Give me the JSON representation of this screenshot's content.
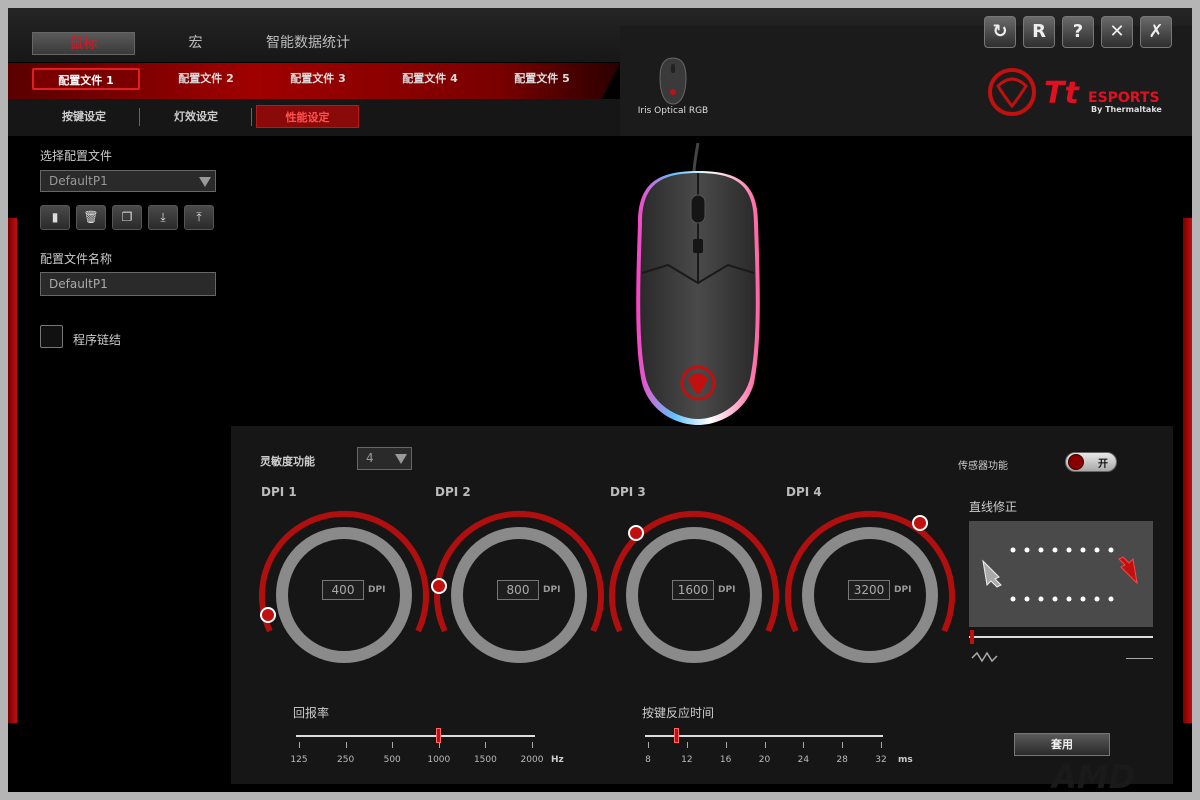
{
  "main_tabs": [
    "鼠标",
    "宏",
    "智能数据统计"
  ],
  "profile_tabs": [
    "配置文件 1",
    "配置文件 2",
    "配置文件 3",
    "配置文件 4",
    "配置文件 5"
  ],
  "sub_tabs": [
    "按键设定",
    "灯效设定",
    "性能设定"
  ],
  "device_name": "Iris Optical RGB",
  "brand": {
    "logo_main": "Tt",
    "logo_sub": "ESPORTS",
    "logo_by": "By Thermaltake"
  },
  "left": {
    "select_profile_label": "选择配置文件",
    "profile_selected": "DefaultP1",
    "profile_name_label": "配置文件名称",
    "profile_name_value": "DefaultP1",
    "program_link_label": "程序链结",
    "icons": [
      "save-icon",
      "trash-icon",
      "copy-icon",
      "import-icon",
      "export-icon"
    ]
  },
  "toolbar_icons": [
    "refresh-icon",
    "reset-icon",
    "help-icon",
    "close-icon",
    "settings-icon"
  ],
  "toolbar_glyphs": [
    "↻",
    "R",
    "?",
    "✕",
    "✗"
  ],
  "sensitivity": {
    "label": "灵敏度功能",
    "value": "4"
  },
  "sensor": {
    "label": "传感器功能",
    "state": "开"
  },
  "dpi": [
    {
      "label": "DPI 1",
      "value": "400",
      "unit": "DPI"
    },
    {
      "label": "DPI 2",
      "value": "800",
      "unit": "DPI"
    },
    {
      "label": "DPI 3",
      "value": "1600",
      "unit": "DPI"
    },
    {
      "label": "DPI 4",
      "value": "3200",
      "unit": "DPI"
    }
  ],
  "angle_snapping": {
    "label": "直线修正"
  },
  "polling": {
    "label": "回报率",
    "ticks": [
      "125",
      "250",
      "500",
      "1000",
      "1500",
      "2000"
    ],
    "unit": "Hz",
    "selected": "1000"
  },
  "response": {
    "label": "按键反应时间",
    "ticks": [
      "8",
      "12",
      "16",
      "20",
      "24",
      "28",
      "32"
    ],
    "unit": "ms",
    "selected": "12"
  },
  "apply_label": "套用",
  "watermark": "AMD",
  "colors": {
    "accent": "#c01010",
    "bg": "#000000",
    "panel": "#161616"
  }
}
